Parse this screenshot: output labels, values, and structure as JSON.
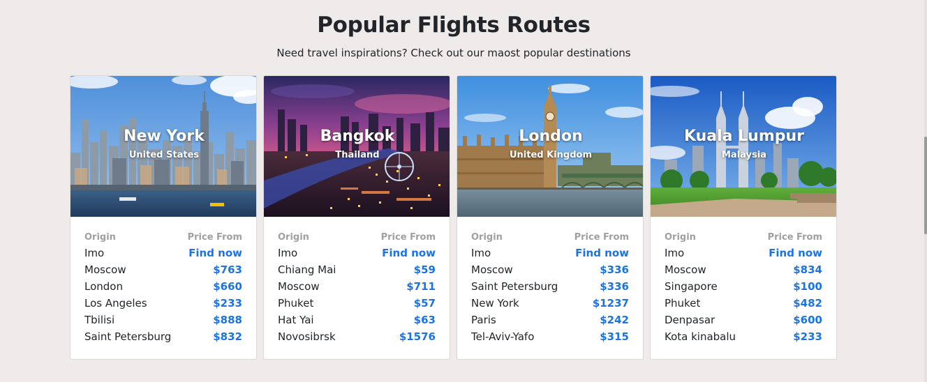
{
  "section": {
    "title": "Popular Flights Routes",
    "subtitle": "Need travel inspirations? Check out our maost popular destinations"
  },
  "colors": {
    "background": "#efebea",
    "link": "#1a73e8",
    "muted": "#a0a0a0"
  },
  "cards": [
    {
      "city": "New York",
      "country": "United States",
      "origin_label": "Origin",
      "price_label": "Price From",
      "routes": [
        {
          "origin": "Imo",
          "price": "Find now"
        },
        {
          "origin": "Moscow",
          "price": "$763"
        },
        {
          "origin": "London",
          "price": "$660"
        },
        {
          "origin": "Los Angeles",
          "price": "$233"
        },
        {
          "origin": "Tbilisi",
          "price": "$888"
        },
        {
          "origin": "Saint Petersburg",
          "price": "$832"
        }
      ]
    },
    {
      "city": "Bangkok",
      "country": "Thailand",
      "origin_label": "Origin",
      "price_label": "Price From",
      "routes": [
        {
          "origin": "Imo",
          "price": "Find now"
        },
        {
          "origin": "Chiang Mai",
          "price": "$59"
        },
        {
          "origin": "Moscow",
          "price": "$711"
        },
        {
          "origin": "Phuket",
          "price": "$57"
        },
        {
          "origin": "Hat Yai",
          "price": "$63"
        },
        {
          "origin": "Novosibrsk",
          "price": "$1576"
        }
      ]
    },
    {
      "city": "London",
      "country": "United Kingdom",
      "origin_label": "Origin",
      "price_label": "Price From",
      "routes": [
        {
          "origin": "Imo",
          "price": "Find now"
        },
        {
          "origin": "Moscow",
          "price": "$336"
        },
        {
          "origin": "Saint Petersburg",
          "price": "$336"
        },
        {
          "origin": "New York",
          "price": "$1237"
        },
        {
          "origin": "Paris",
          "price": "$242"
        },
        {
          "origin": "Tel-Aviv-Yafo",
          "price": "$315"
        }
      ]
    },
    {
      "city": "Kuala Lumpur",
      "country": "Malaysia",
      "origin_label": "Origin",
      "price_label": "Price From",
      "routes": [
        {
          "origin": "Imo",
          "price": "Find now"
        },
        {
          "origin": "Moscow",
          "price": "$834"
        },
        {
          "origin": "Singapore",
          "price": "$100"
        },
        {
          "origin": "Phuket",
          "price": "$482"
        },
        {
          "origin": "Denpasar",
          "price": "$600"
        },
        {
          "origin": "Kota kinabalu",
          "price": "$233"
        }
      ]
    }
  ]
}
